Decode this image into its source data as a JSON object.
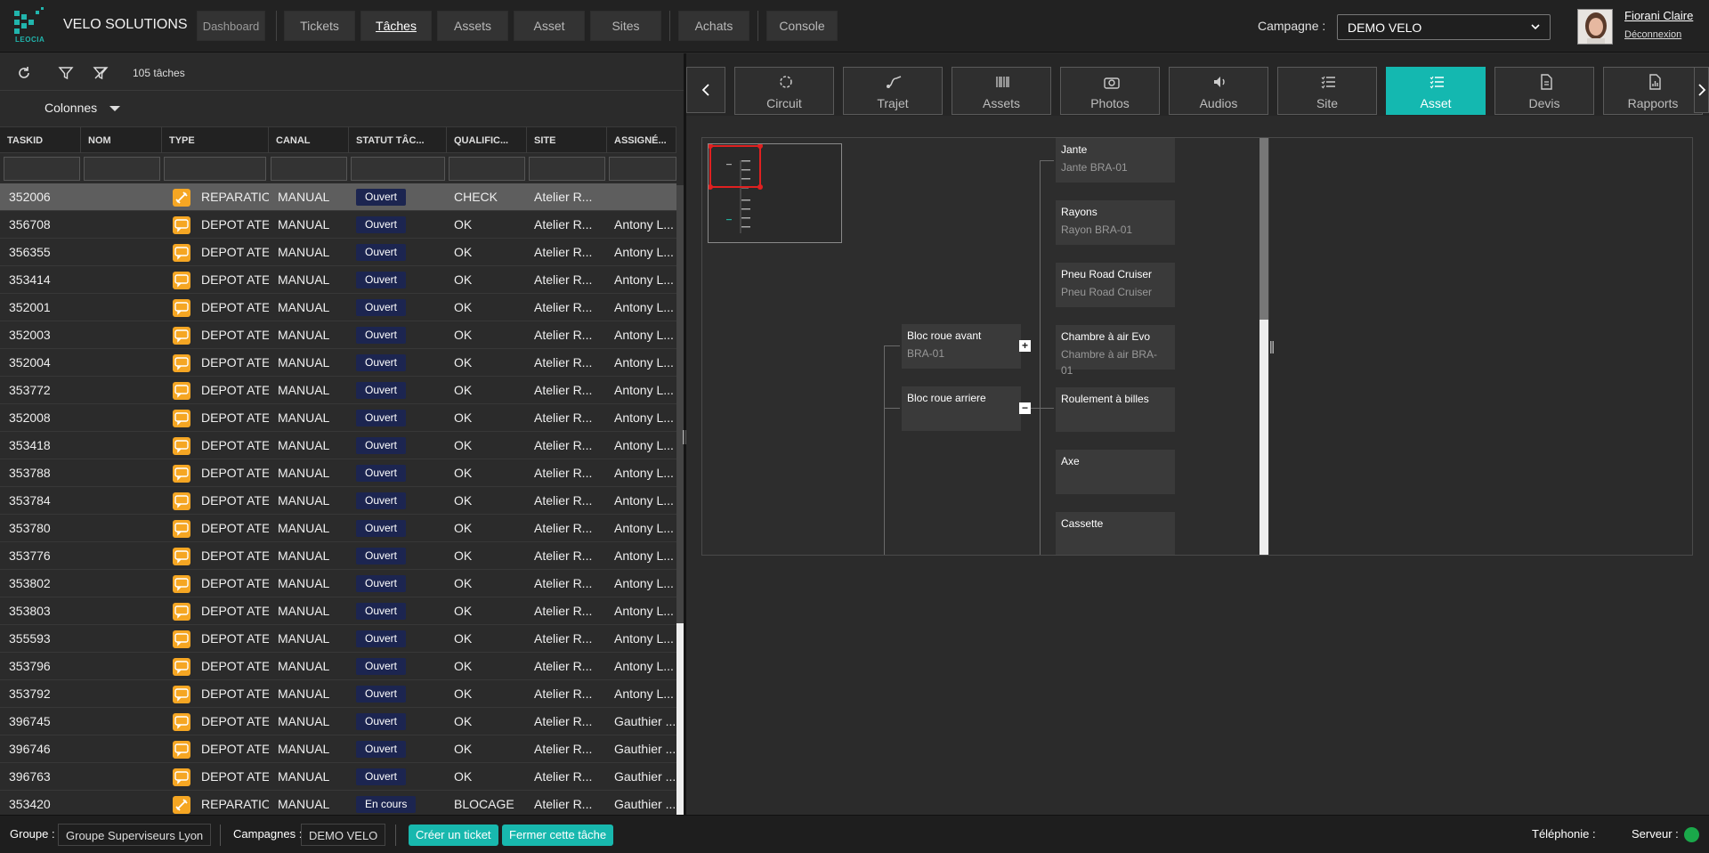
{
  "app": {
    "title": "VELO SOLUTIONS",
    "logo_text": "LEOCIA"
  },
  "nav": {
    "items": [
      "Dashboard",
      "Tickets",
      "Tâches",
      "Assets",
      "Asset",
      "Sites",
      "Achats",
      "Console"
    ],
    "active": "Tâches"
  },
  "campaign": {
    "label": "Campagne :",
    "value": "DEMO VELO"
  },
  "user": {
    "name": "Fiorani Claire",
    "logout": "Déconnexion"
  },
  "tasks": {
    "count_label": "105 tâches",
    "columns_button": "Colonnes",
    "columns": [
      "TASKID",
      "NOM",
      "TYPE",
      "CANAL",
      "STATUT TÂC...",
      "QUALIFIC...",
      "SITE",
      "ASSIGNÉ..."
    ],
    "rows": [
      {
        "taskid": "352006",
        "nom": "",
        "type": "REPARATION",
        "canal": "MANUAL",
        "statut": "Ouvert",
        "qualif": "CHECK",
        "site": "Atelier R...",
        "assigne": ""
      },
      {
        "taskid": "356708",
        "nom": "",
        "type": "DEPOT ATE",
        "canal": "MANUAL",
        "statut": "Ouvert",
        "qualif": "OK",
        "site": "Atelier R...",
        "assigne": "Antony L..."
      },
      {
        "taskid": "356355",
        "nom": "",
        "type": "DEPOT ATE",
        "canal": "MANUAL",
        "statut": "Ouvert",
        "qualif": "OK",
        "site": "Atelier R...",
        "assigne": "Antony L..."
      },
      {
        "taskid": "353414",
        "nom": "",
        "type": "DEPOT ATE",
        "canal": "MANUAL",
        "statut": "Ouvert",
        "qualif": "OK",
        "site": "Atelier R...",
        "assigne": "Antony L..."
      },
      {
        "taskid": "352001",
        "nom": "",
        "type": "DEPOT ATE",
        "canal": "MANUAL",
        "statut": "Ouvert",
        "qualif": "OK",
        "site": "Atelier R...",
        "assigne": "Antony L..."
      },
      {
        "taskid": "352003",
        "nom": "",
        "type": "DEPOT ATE",
        "canal": "MANUAL",
        "statut": "Ouvert",
        "qualif": "OK",
        "site": "Atelier R...",
        "assigne": "Antony L..."
      },
      {
        "taskid": "352004",
        "nom": "",
        "type": "DEPOT ATE",
        "canal": "MANUAL",
        "statut": "Ouvert",
        "qualif": "OK",
        "site": "Atelier R...",
        "assigne": "Antony L..."
      },
      {
        "taskid": "353772",
        "nom": "",
        "type": "DEPOT ATE",
        "canal": "MANUAL",
        "statut": "Ouvert",
        "qualif": "OK",
        "site": "Atelier R...",
        "assigne": "Antony L..."
      },
      {
        "taskid": "352008",
        "nom": "",
        "type": "DEPOT ATE",
        "canal": "MANUAL",
        "statut": "Ouvert",
        "qualif": "OK",
        "site": "Atelier R...",
        "assigne": "Antony L..."
      },
      {
        "taskid": "353418",
        "nom": "",
        "type": "DEPOT ATE",
        "canal": "MANUAL",
        "statut": "Ouvert",
        "qualif": "OK",
        "site": "Atelier R...",
        "assigne": "Antony L..."
      },
      {
        "taskid": "353788",
        "nom": "",
        "type": "DEPOT ATE",
        "canal": "MANUAL",
        "statut": "Ouvert",
        "qualif": "OK",
        "site": "Atelier R...",
        "assigne": "Antony L..."
      },
      {
        "taskid": "353784",
        "nom": "",
        "type": "DEPOT ATE",
        "canal": "MANUAL",
        "statut": "Ouvert",
        "qualif": "OK",
        "site": "Atelier R...",
        "assigne": "Antony L..."
      },
      {
        "taskid": "353780",
        "nom": "",
        "type": "DEPOT ATE",
        "canal": "MANUAL",
        "statut": "Ouvert",
        "qualif": "OK",
        "site": "Atelier R...",
        "assigne": "Antony L..."
      },
      {
        "taskid": "353776",
        "nom": "",
        "type": "DEPOT ATE",
        "canal": "MANUAL",
        "statut": "Ouvert",
        "qualif": "OK",
        "site": "Atelier R...",
        "assigne": "Antony L..."
      },
      {
        "taskid": "353802",
        "nom": "",
        "type": "DEPOT ATE",
        "canal": "MANUAL",
        "statut": "Ouvert",
        "qualif": "OK",
        "site": "Atelier R...",
        "assigne": "Antony L..."
      },
      {
        "taskid": "353803",
        "nom": "",
        "type": "DEPOT ATE",
        "canal": "MANUAL",
        "statut": "Ouvert",
        "qualif": "OK",
        "site": "Atelier R...",
        "assigne": "Antony L..."
      },
      {
        "taskid": "355593",
        "nom": "",
        "type": "DEPOT ATE",
        "canal": "MANUAL",
        "statut": "Ouvert",
        "qualif": "OK",
        "site": "Atelier R...",
        "assigne": "Antony L..."
      },
      {
        "taskid": "353796",
        "nom": "",
        "type": "DEPOT ATE",
        "canal": "MANUAL",
        "statut": "Ouvert",
        "qualif": "OK",
        "site": "Atelier R...",
        "assigne": "Antony L..."
      },
      {
        "taskid": "353792",
        "nom": "",
        "type": "DEPOT ATE",
        "canal": "MANUAL",
        "statut": "Ouvert",
        "qualif": "OK",
        "site": "Atelier R...",
        "assigne": "Antony L..."
      },
      {
        "taskid": "396745",
        "nom": "",
        "type": "DEPOT ATE",
        "canal": "MANUAL",
        "statut": "Ouvert",
        "qualif": "OK",
        "site": "Atelier R...",
        "assigne": "Gauthier ..."
      },
      {
        "taskid": "396746",
        "nom": "",
        "type": "DEPOT ATE",
        "canal": "MANUAL",
        "statut": "Ouvert",
        "qualif": "OK",
        "site": "Atelier R...",
        "assigne": "Gauthier ..."
      },
      {
        "taskid": "396763",
        "nom": "",
        "type": "DEPOT ATE",
        "canal": "MANUAL",
        "statut": "Ouvert",
        "qualif": "OK",
        "site": "Atelier R...",
        "assigne": "Gauthier ..."
      },
      {
        "taskid": "353420",
        "nom": "",
        "type": "REPARATION",
        "canal": "MANUAL",
        "statut": "En cours",
        "qualif": "BLOCAGE",
        "site": "Atelier R...",
        "assigne": "Gauthier ..."
      }
    ]
  },
  "detail_tabs": [
    {
      "label": "Circuit",
      "icon": "circuit-icon"
    },
    {
      "label": "Trajet",
      "icon": "route-icon"
    },
    {
      "label": "Assets",
      "icon": "barcode-icon"
    },
    {
      "label": "Photos",
      "icon": "camera-icon"
    },
    {
      "label": "Audios",
      "icon": "speaker-icon"
    },
    {
      "label": "Site",
      "icon": "list-icon"
    },
    {
      "label": "Asset",
      "icon": "list-icon"
    },
    {
      "label": "Devis",
      "icon": "document-icon"
    },
    {
      "label": "Rapports",
      "icon": "report-icon"
    }
  ],
  "detail_active_tab": "Asset",
  "asset_tree": {
    "groups": [
      {
        "title": "Bloc roue avant",
        "subtitle": "BRA-01",
        "toggle": "+"
      },
      {
        "title": "Bloc roue arriere",
        "subtitle": "",
        "toggle": "−"
      }
    ],
    "parts": [
      {
        "title": "Jante",
        "subtitle": "Jante BRA-01"
      },
      {
        "title": "Rayons",
        "subtitle": "Rayon BRA-01"
      },
      {
        "title": "Pneu Road Cruiser",
        "subtitle": "Pneu Road Cruiser"
      },
      {
        "title": "Chambre à air Evo",
        "subtitle": "Chambre à air BRA-01"
      },
      {
        "title": "Roulement à billes",
        "subtitle": ""
      },
      {
        "title": "Axe",
        "subtitle": ""
      },
      {
        "title": "Cassette",
        "subtitle": ""
      }
    ]
  },
  "footer": {
    "group_label": "Groupe :",
    "group_value": "Groupe Superviseurs Lyon",
    "campaigns_label": "Campagnes :",
    "campaigns_value": "DEMO VELO",
    "create_ticket": "Créer un ticket",
    "close_task": "Fermer cette tâche",
    "telephony_label": "Téléphonie :",
    "server_label": "Serveur :"
  },
  "colors": {
    "accent": "#14b8b0",
    "status_badge": "#1c2550",
    "type_icon": "#f5a623",
    "server_ok": "#1aa84a",
    "minimap_selection": "#e02020"
  }
}
